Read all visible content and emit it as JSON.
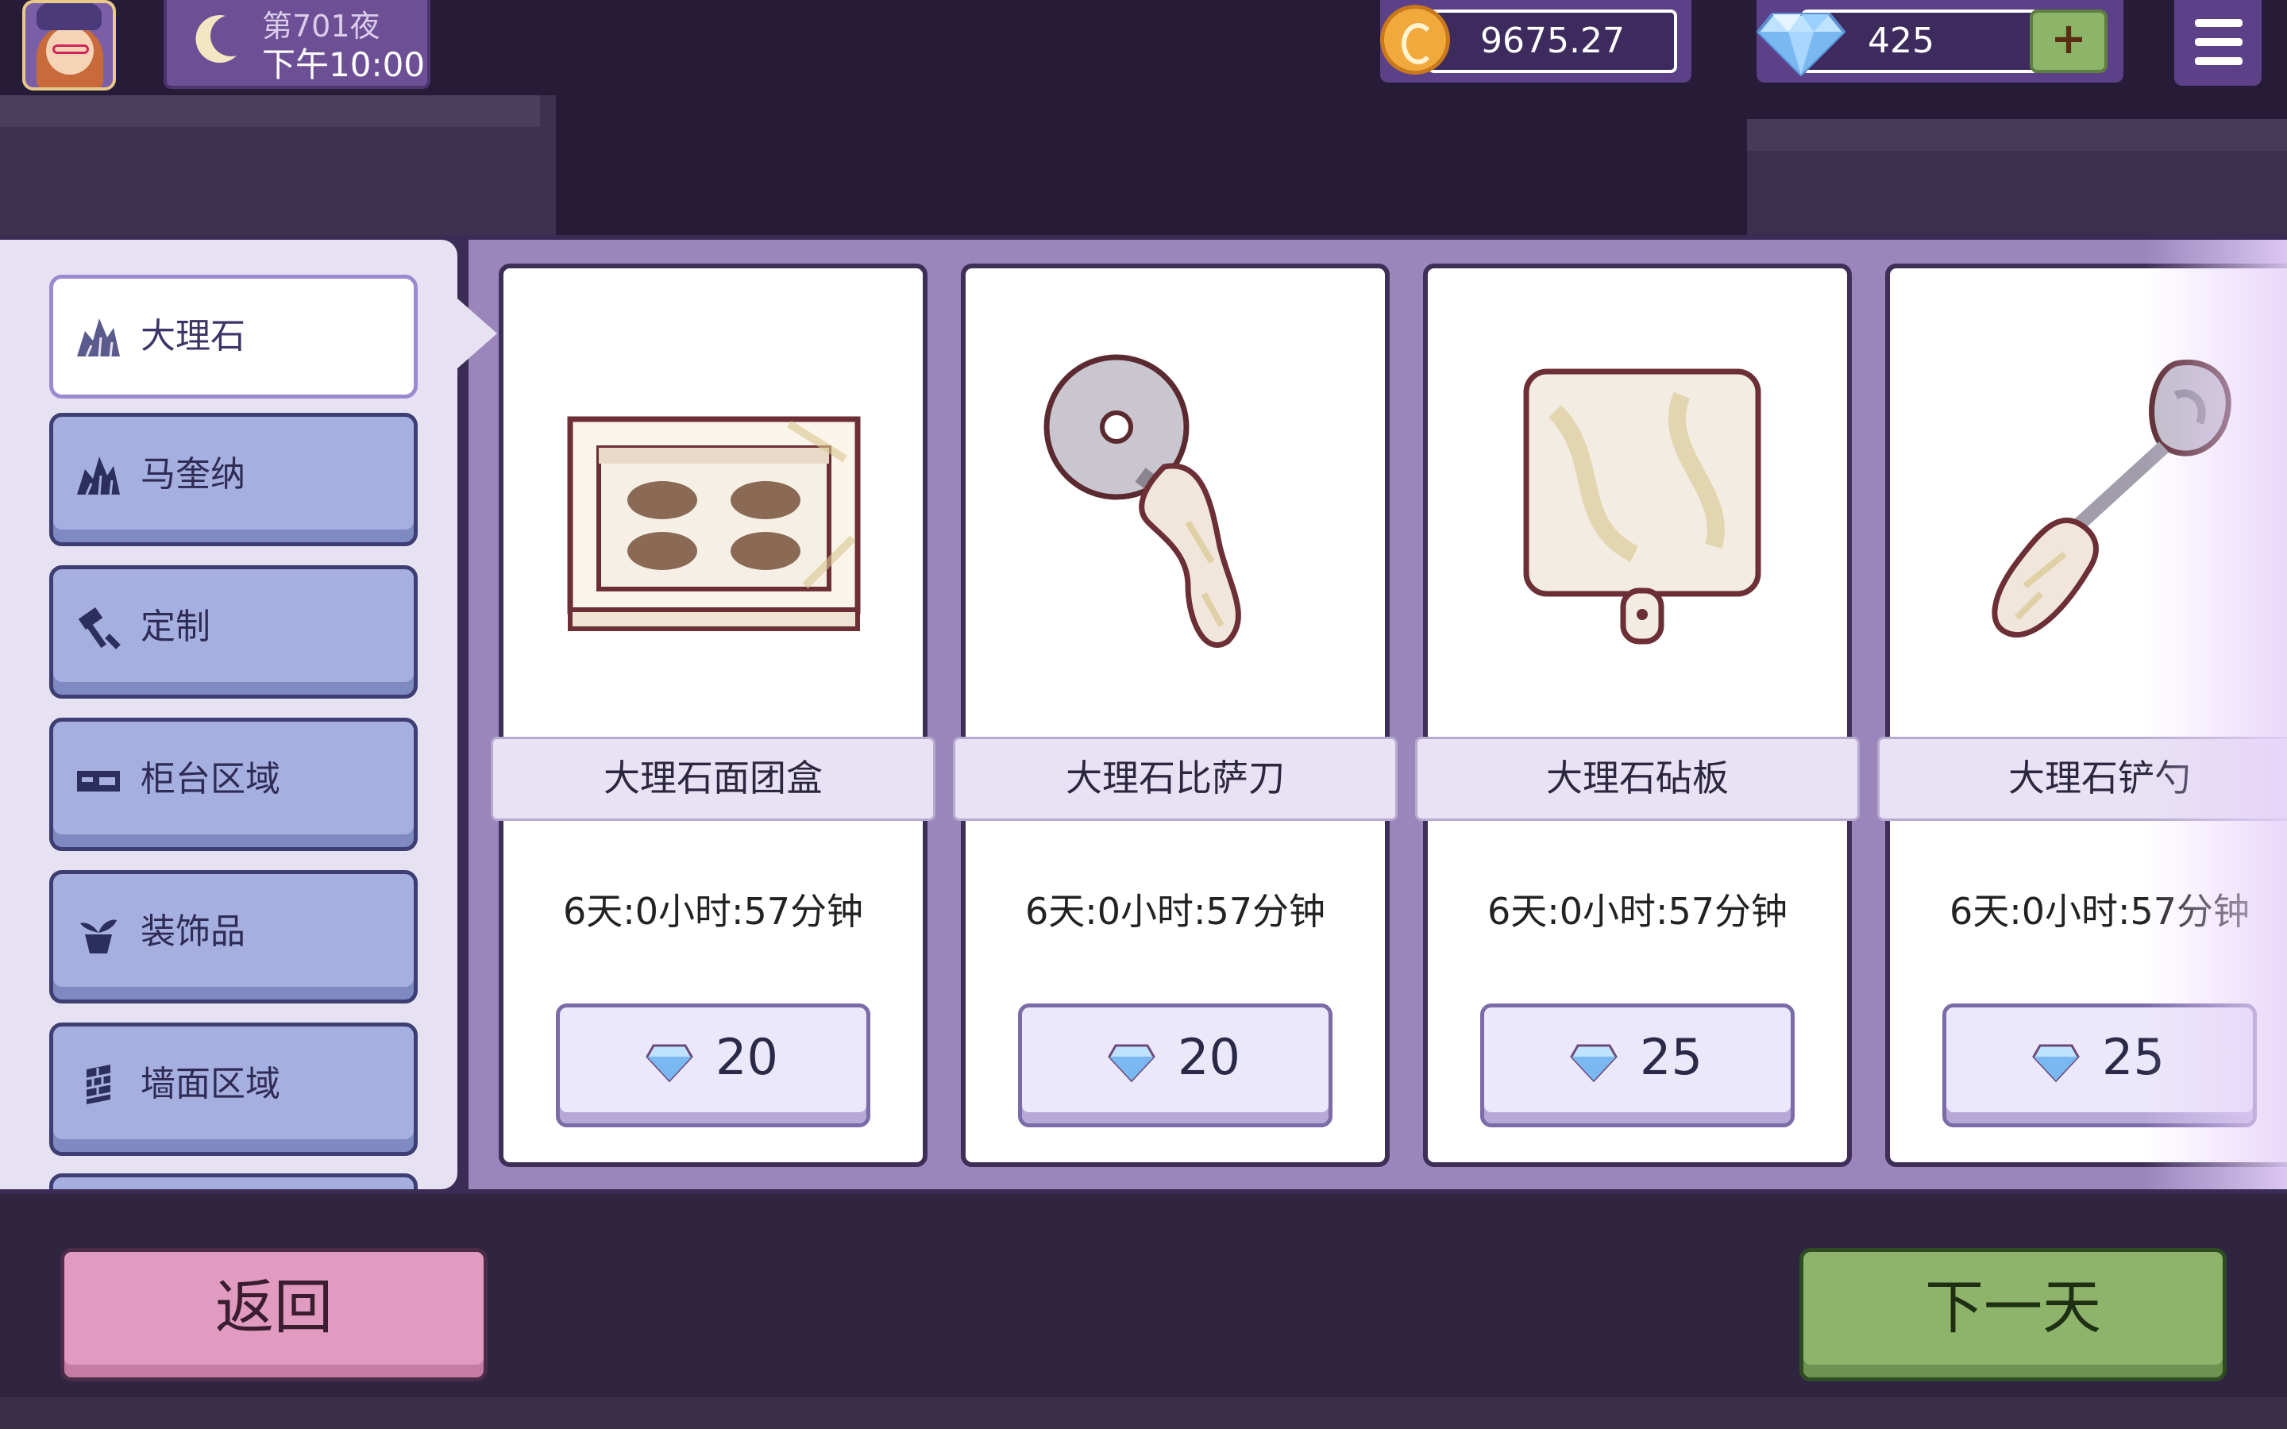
{
  "hud": {
    "night": "第701夜",
    "time": "下午10:00",
    "coins": "9675.27",
    "gems": "425",
    "plus": "+"
  },
  "sidebar": {
    "items": [
      {
        "label": "大理石",
        "icon": "marble-icon",
        "active": true
      },
      {
        "label": "马奎纳",
        "icon": "mountain-icon",
        "active": false
      },
      {
        "label": "定制",
        "icon": "hammer-icon",
        "active": false
      },
      {
        "label": "柜台区域",
        "icon": "counter-icon",
        "active": false
      },
      {
        "label": "装饰品",
        "icon": "plant-pot-icon",
        "active": false
      },
      {
        "label": "墙面区域",
        "icon": "wall-icon",
        "active": false
      }
    ]
  },
  "cards": [
    {
      "name": "大理石面团盒",
      "timer": "6天:0小时:57分钟",
      "price": "20",
      "image": "dough-box-icon"
    },
    {
      "name": "大理石比萨刀",
      "timer": "6天:0小时:57分钟",
      "price": "20",
      "image": "pizza-cutter-icon"
    },
    {
      "name": "大理石砧板",
      "timer": "6天:0小时:57分钟",
      "price": "25",
      "image": "cutting-board-icon"
    },
    {
      "name": "大理石铲勺",
      "timer": "6天:0小时:57分钟",
      "price": "25",
      "image": "spatula-icon"
    }
  ],
  "footer": {
    "back": "返回",
    "next": "下一天"
  },
  "colors": {
    "panel": "#9a86bb",
    "sidebar_btn": "#a6b0e0",
    "back_btn": "#e19ac0",
    "next_btn": "#8db46a"
  }
}
